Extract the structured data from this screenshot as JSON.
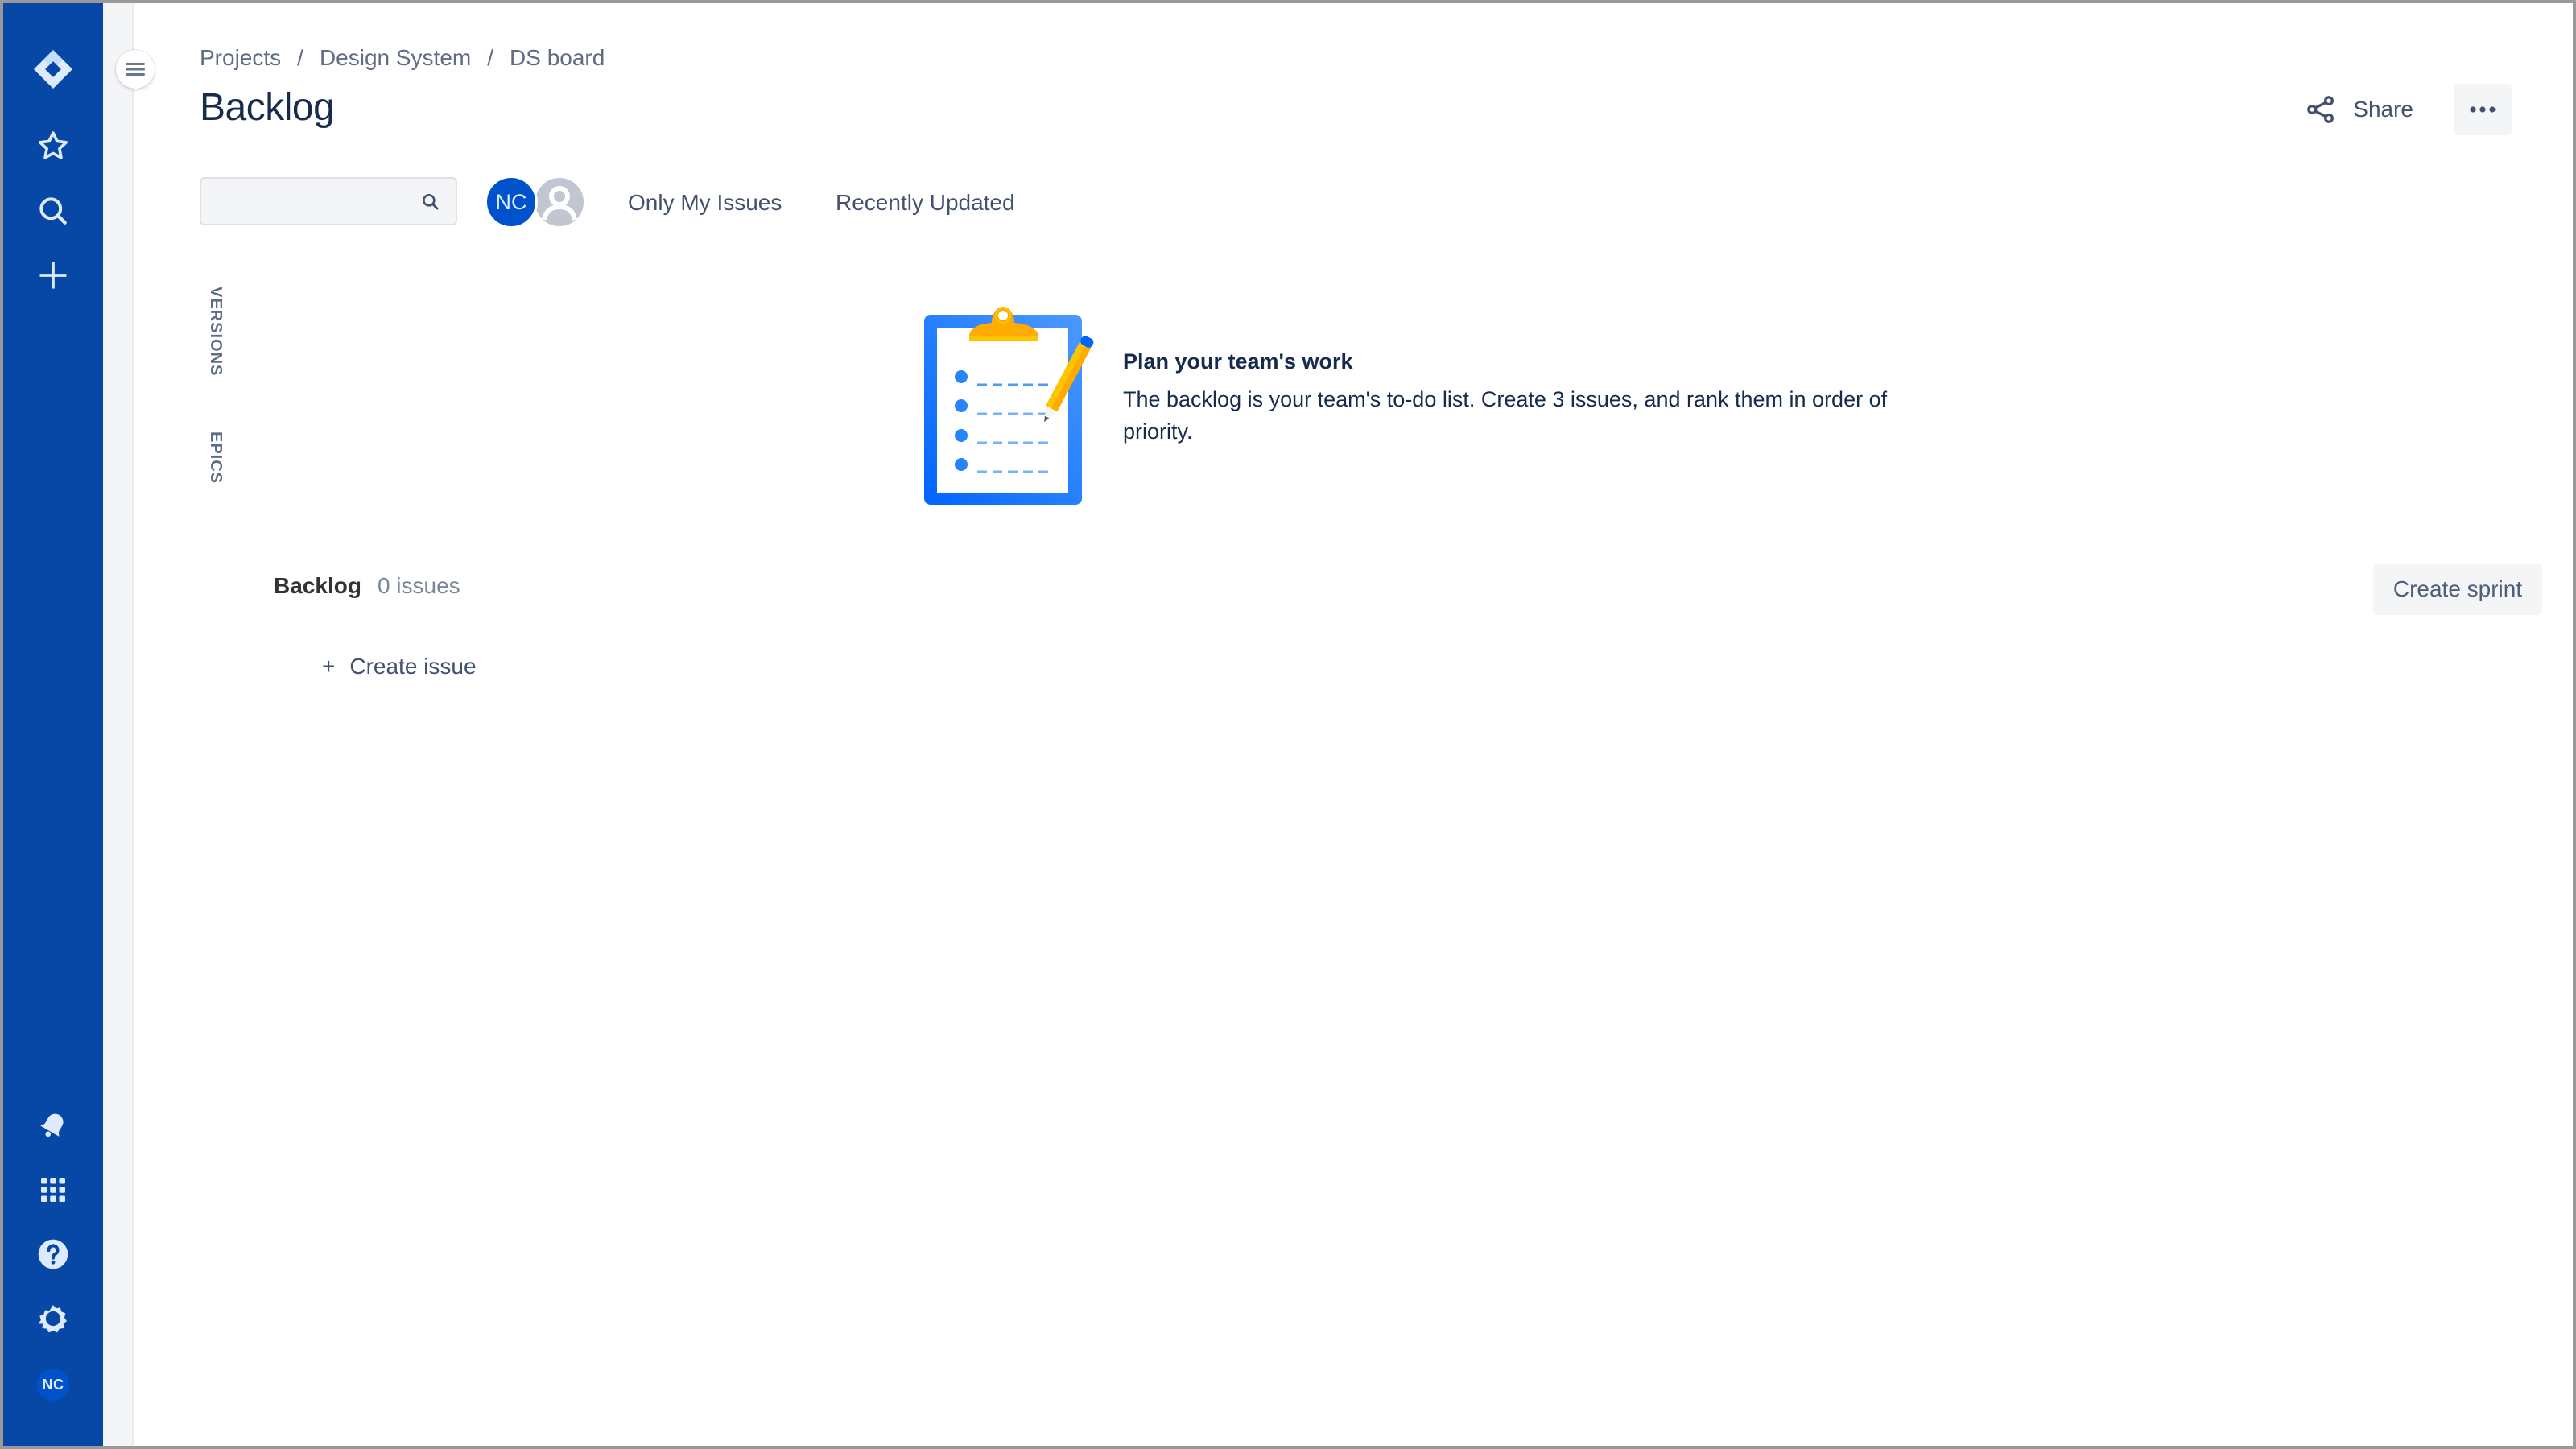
{
  "global_nav": {
    "top_items": [
      {
        "name": "jira-logo",
        "label": "Jira"
      },
      {
        "name": "starred",
        "label": "Starred"
      },
      {
        "name": "search",
        "label": "Search"
      },
      {
        "name": "create",
        "label": "Create"
      }
    ],
    "bottom_items": [
      {
        "name": "notifications",
        "label": "Notifications"
      },
      {
        "name": "app-switcher",
        "label": "App switcher"
      },
      {
        "name": "help",
        "label": "Help"
      },
      {
        "name": "settings",
        "label": "Settings"
      }
    ],
    "profile_initials": "NC",
    "brand_color": "#0747a6"
  },
  "breadcrumb": [
    {
      "label": "Projects"
    },
    {
      "label": "Design System"
    },
    {
      "label": "DS board"
    }
  ],
  "breadcrumb_separator": "/",
  "page_title": "Backlog",
  "header_actions": {
    "share_label": "Share",
    "more_label": "More actions"
  },
  "filters": {
    "search_value": "",
    "search_placeholder": "",
    "avatars": [
      {
        "initials": "NC",
        "color": "#0052cc"
      },
      {
        "initials": "",
        "kind": "unassigned",
        "color": "#c1c7d0"
      }
    ],
    "quick_filters": [
      "Only My Issues",
      "Recently Updated"
    ]
  },
  "side_tabs": [
    "VERSIONS",
    "EPICS"
  ],
  "empty_state": {
    "title": "Plan your team's work",
    "body": "The backlog is your team's to-do list. Create 3 issues, and rank them in order of priority."
  },
  "backlog": {
    "name": "Backlog",
    "count_label": "0 issues",
    "create_sprint_label": "Create sprint",
    "create_issue_label": "Create issue",
    "create_issue_icon": "+"
  }
}
